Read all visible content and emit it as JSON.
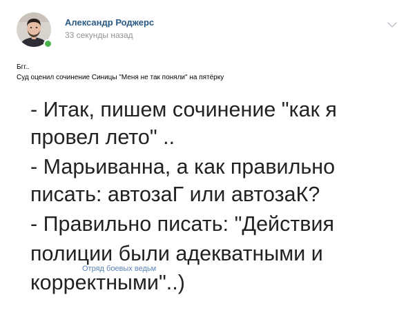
{
  "post": {
    "author_name": "Александр Роджерс",
    "time": "33 секунды назад",
    "text_lines": [
      "Бгг..",
      "Суд оценил сочинение Синицы \"Меня не так поняли\" на пятёрку"
    ],
    "meme": {
      "lines": [
        "- Итак, пишем сочинение \"как я",
        "провел лето\" ..",
        "- Марьиванна, а как правильно",
        "писать: автозаГ или автозаК?",
        "- Правильно писать: \"Действия",
        "полиции были адекватными и",
        "корректными\"..)"
      ],
      "watermark": "Отряд боевых ведьм"
    }
  },
  "icons": {
    "menu": "chevron-down-icon",
    "online": "online-status-icon"
  },
  "colors": {
    "author_link": "#2a5885",
    "meta_text": "#939393",
    "online_dot": "#4bb34b",
    "watermark": "#5a82b8"
  }
}
